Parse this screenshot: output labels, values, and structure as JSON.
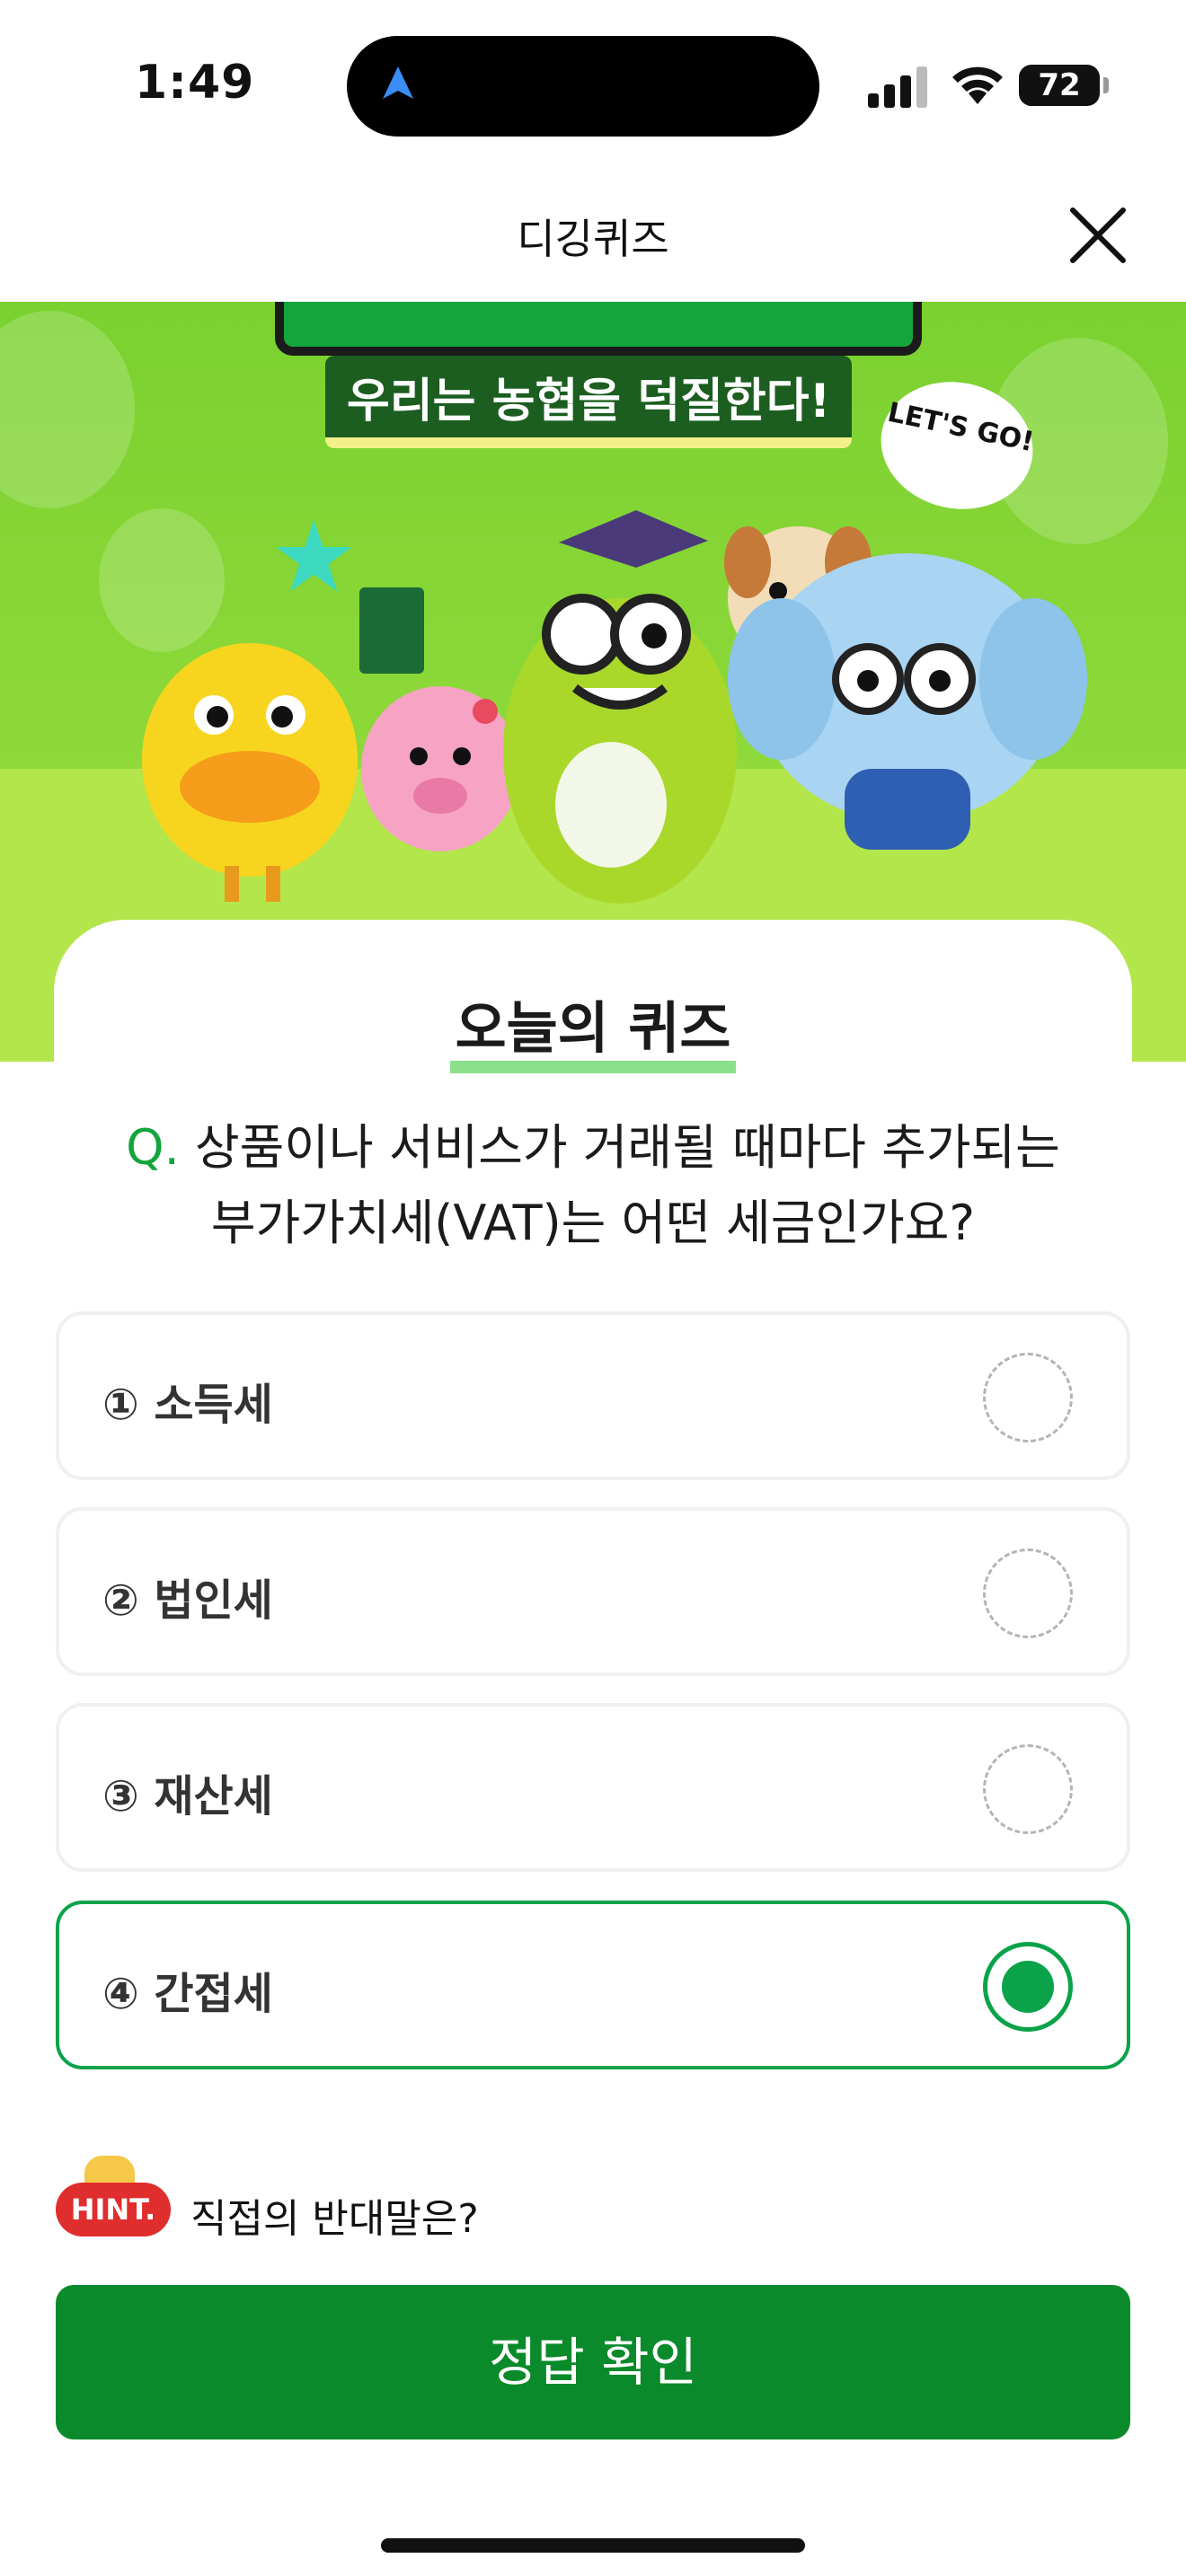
{
  "status": {
    "time": "1:49",
    "battery": "72"
  },
  "header": {
    "title": "디깅퀴즈"
  },
  "banner": {
    "slogan": "우리는 농협을 덕질한다!",
    "bubble": "LET'S GO!"
  },
  "quiz": {
    "title": "오늘의 퀴즈",
    "prefix": "Q.",
    "question_line1": "상품이나 서비스가 거래될 때마다 추가되는",
    "question_line2": "부가가치세(VAT)는 어떤 세금인가요?"
  },
  "options": [
    {
      "label": "① 소득세",
      "selected": false
    },
    {
      "label": "② 법인세",
      "selected": false
    },
    {
      "label": "③ 재산세",
      "selected": false
    },
    {
      "label": "④ 간접세",
      "selected": true
    }
  ],
  "hint": {
    "badge": "HINT.",
    "text": "직접의 반대말은?"
  },
  "submit": {
    "label": "정답 확인"
  },
  "colors": {
    "accent": "#0aa34a",
    "button": "#0a8a2a",
    "banner": "#8ed93a"
  }
}
